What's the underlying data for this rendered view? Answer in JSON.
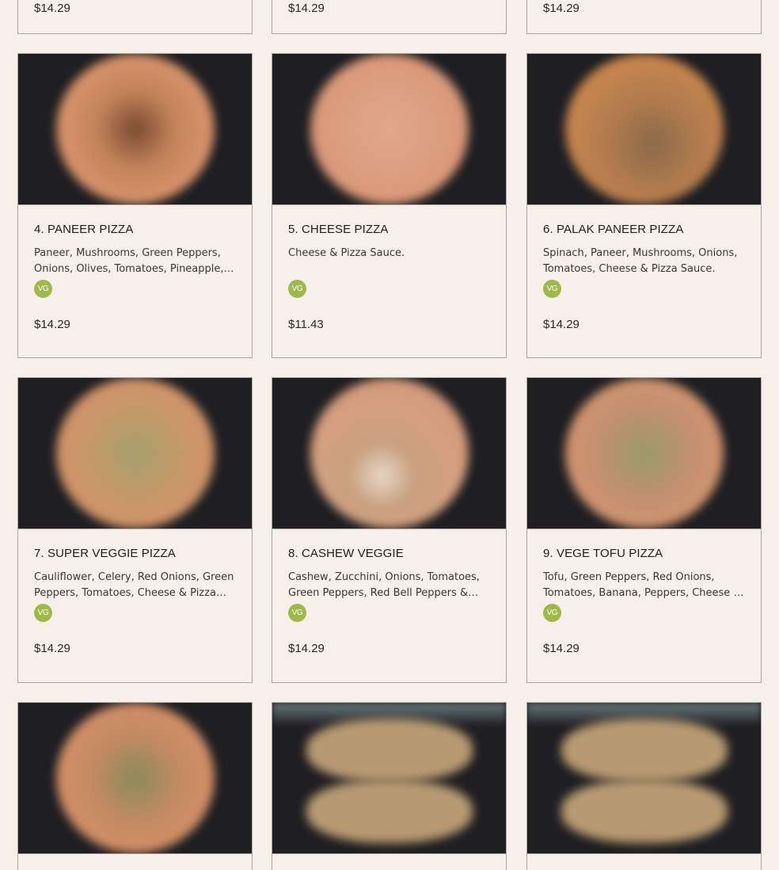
{
  "top_row": [
    {
      "price": "$14.29"
    },
    {
      "price": "$14.29"
    },
    {
      "price": "$14.29"
    }
  ],
  "menu_items": [
    {
      "title": "4. PANEER PIZZA",
      "description": "Paneer, Mushrooms, Green Peppers, Onions, Olives, Tomatoes, Pineapple, Cheese & Pizza Sauce.",
      "badge": "VG",
      "price": "$14.29",
      "photo": "pizza-photo"
    },
    {
      "title": "5. CHEESE PIZZA",
      "description": "Cheese & Pizza Sauce.",
      "badge": "VG",
      "price": "$11.43",
      "photo": "pizza-photo"
    },
    {
      "title": "6. PALAK PANEER PIZZA",
      "description": "Spinach, Paneer, Mushrooms, Onions, Tomatoes, Cheese & Pizza Sauce.",
      "badge": "VG",
      "price": "$14.29",
      "photo": "pizza-photo"
    },
    {
      "title": "7. SUPER VEGGIE PIZZA",
      "description": "Cauliflower, Celery, Red Onions, Green Peppers, Tomatoes, Cheese & Pizza Sauce.",
      "badge": "VG",
      "price": "$14.29",
      "photo": "pizza-photo"
    },
    {
      "title": "8. CASHEW VEGGIE",
      "description": "Cashew, Zucchini, Onions, Tomatoes, Green Peppers, Red Bell Peppers & Cheese.",
      "badge": "VG",
      "price": "$14.29",
      "photo": "pizza-photo"
    },
    {
      "title": "9. VEGE TOFU PIZZA",
      "description": "Tofu, Green Peppers, Red Onions, Tomatoes, Banana, Peppers, Cheese & Pizza Sauce.",
      "badge": "VG",
      "price": "$14.29",
      "photo": "pizza-photo"
    }
  ],
  "bottom_row": [
    {
      "photo": "pizza-photo"
    },
    {
      "photo": "pizza-photo"
    },
    {
      "photo": "pizza-photo"
    }
  ],
  "colors": {
    "background": "#f7f0ea",
    "badge": "#9fb84e",
    "border": "#a9a6a2",
    "photo_bg": "#1f1e22"
  }
}
